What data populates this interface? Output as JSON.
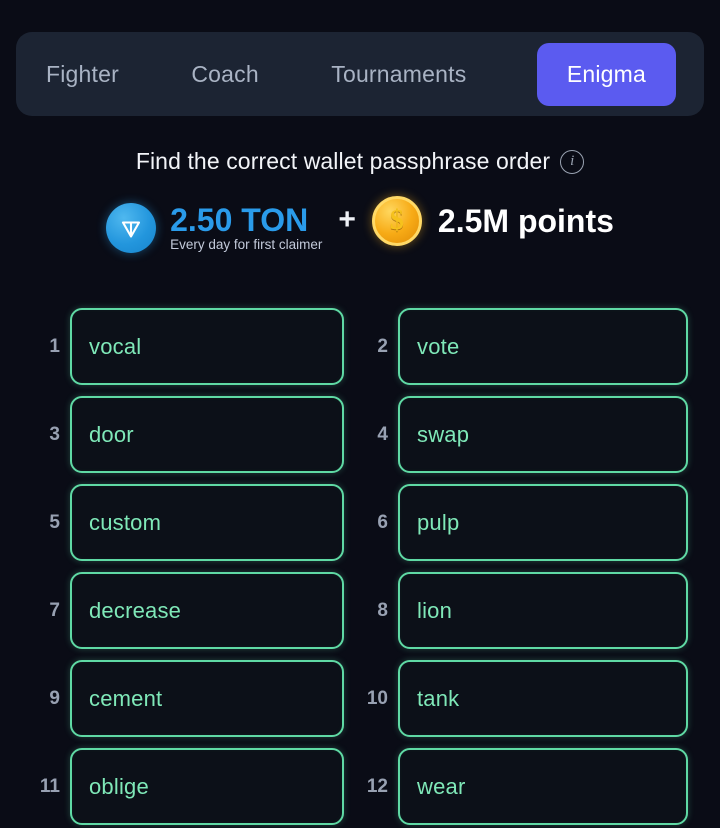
{
  "nav": {
    "tabs": [
      {
        "label": "Fighter",
        "active": false
      },
      {
        "label": "Coach",
        "active": false
      },
      {
        "label": "Tournaments",
        "active": false
      },
      {
        "label": "Enigma",
        "active": true
      }
    ],
    "active_color": "#5b5bf0",
    "bar_color": "#1c2433"
  },
  "header": {
    "title": "Find the correct wallet passphrase order",
    "info_icon": "info-icon",
    "info_glyph": "i"
  },
  "reward": {
    "ton_icon": "ton-coin-icon",
    "ton_amount": "2.50 TON",
    "ton_subtitle": "Every day for first claimer",
    "ton_color": "#2a9bea",
    "plus": "+",
    "points_icon": "gold-coin-icon",
    "points_glyph": "$",
    "points_amount": "2.5M points",
    "points_color": "#ffffff"
  },
  "grid": {
    "border_color": "#5fd9a4",
    "word_color": "#7fe8b8",
    "index_color": "#98a1b2",
    "words": [
      {
        "index": "1",
        "word": "vocal"
      },
      {
        "index": "2",
        "word": "vote"
      },
      {
        "index": "3",
        "word": "door"
      },
      {
        "index": "4",
        "word": "swap"
      },
      {
        "index": "5",
        "word": "custom"
      },
      {
        "index": "6",
        "word": "pulp"
      },
      {
        "index": "7",
        "word": "decrease"
      },
      {
        "index": "8",
        "word": "lion"
      },
      {
        "index": "9",
        "word": "cement"
      },
      {
        "index": "10",
        "word": "tank"
      },
      {
        "index": "11",
        "word": "oblige"
      },
      {
        "index": "12",
        "word": "wear"
      }
    ]
  },
  "page": {
    "background": "#0a0c16"
  }
}
